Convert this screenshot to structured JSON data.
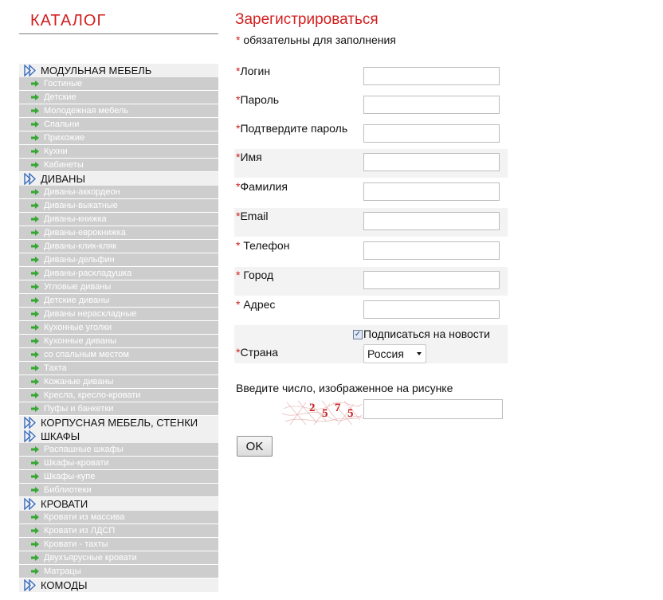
{
  "sidebar": {
    "title": "КАТАЛОГ",
    "categories": [
      {
        "label": "МОДУЛЬНАЯ МЕБЕЛЬ",
        "items": [
          "Гостиные",
          "Детские",
          "Молодежная мебель",
          "Спальни",
          "Прихожие",
          "Кухни",
          "Кабинеты"
        ]
      },
      {
        "label": "ДИВАНЫ",
        "items": [
          "Диваны-аккордеон",
          "Диваны-выкатные",
          "Диваны-книжка",
          "Диваны-еврокнижка",
          "Диваны-клик-кляк",
          "Диваны-дельфин",
          "Диваны-раскладушка",
          "Угловые диваны",
          "Детские диваны",
          "Диваны нераскладные",
          "Кухонные уголки",
          "Кухонные диваны",
          "со спальным местом",
          "Тахта",
          "Кожаные диваны",
          "Кресла, кресло-кровати",
          "Пуфы и банкетки"
        ]
      },
      {
        "label": "КОРПУСНАЯ МЕБЕЛЬ, СТЕНКИ",
        "items": []
      },
      {
        "label": "ШКАФЫ",
        "items": [
          "Распашные шкафы",
          "Шкафы-кровати",
          "Шкафы-купе",
          "Библиотеки"
        ]
      },
      {
        "label": "КРОВАТИ",
        "items": [
          "Кровати из массива",
          "Кровати из ЛДСП",
          "Кровати - тахты",
          "Двухъярусные кровати",
          "Матрацы"
        ]
      },
      {
        "label": "КОМОДЫ",
        "items": []
      }
    ]
  },
  "form": {
    "title": "Зарегистрироваться",
    "required_star": "*",
    "required_note": " обязательны для заполнения",
    "fields": {
      "login": {
        "label": "Логин",
        "value": ""
      },
      "password": {
        "label": "Пароль",
        "value": ""
      },
      "password_confirm": {
        "label": "Подтвердите пароль",
        "value": ""
      },
      "name": {
        "label": "Имя",
        "value": ""
      },
      "surname": {
        "label": "Фамилия",
        "value": ""
      },
      "email": {
        "label": "Email",
        "value": ""
      },
      "phone": {
        "label": " Телефон",
        "value": ""
      },
      "city": {
        "label": " Город",
        "value": ""
      },
      "address": {
        "label": " Адрес",
        "value": ""
      }
    },
    "subscribe": {
      "label": "Подписаться на новости",
      "checked": true
    },
    "country": {
      "label": "Страна",
      "value": "Россия"
    },
    "captcha": {
      "label": "Введите число, изображенное на рисунке",
      "code": "2575",
      "value": ""
    },
    "submit_label": "OK"
  },
  "colors": {
    "accent": "#d21f1f",
    "category_bg": "#f0f0f0",
    "item_bg": "#cdcdcd",
    "field_row_bg": "#f3f3f3",
    "arrow_green": "#35a832",
    "category_icon": "#3a6dbf"
  }
}
